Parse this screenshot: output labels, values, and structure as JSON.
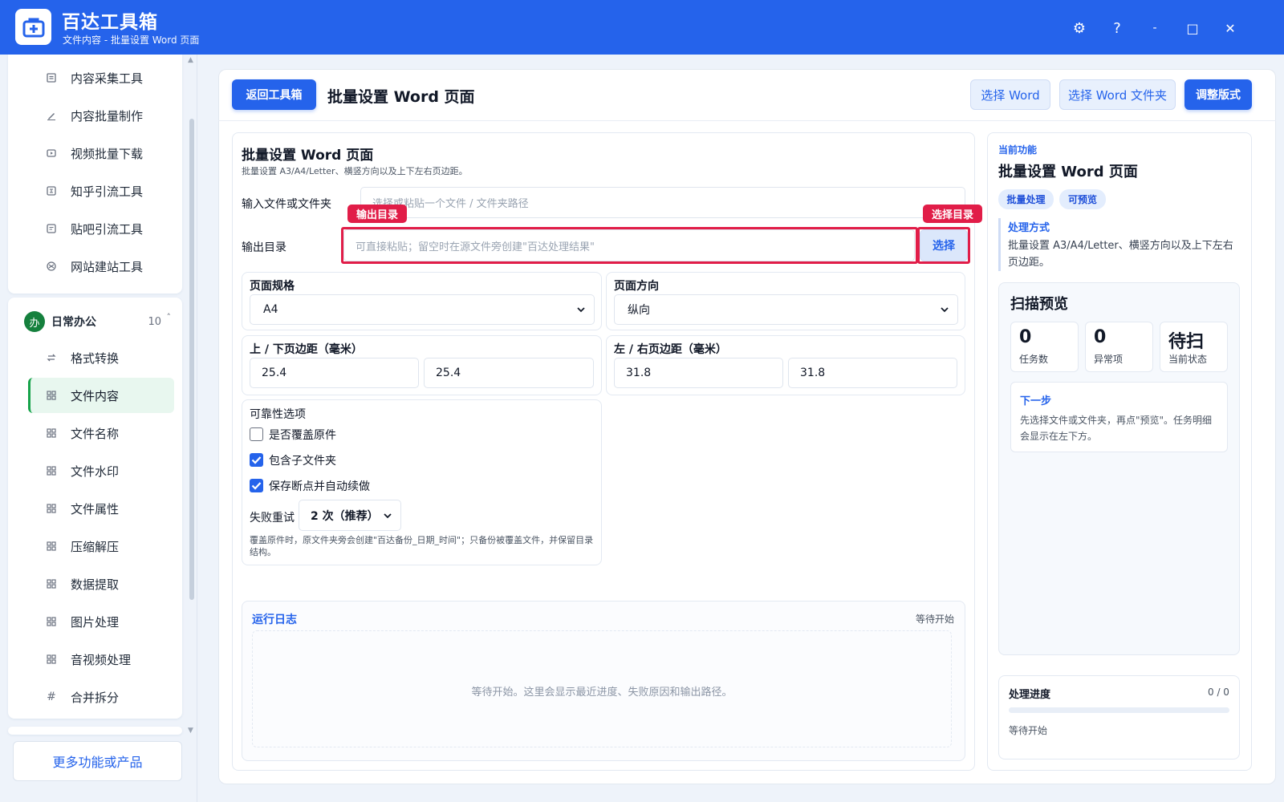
{
  "app": {
    "title": "百达工具箱",
    "subtitle": "文件内容 - 批量设置 Word 页面"
  },
  "window_controls": {
    "settings": "⚙",
    "help": "?",
    "minimize": "-",
    "maximize": "□",
    "close": "✕"
  },
  "sidebar": {
    "top_items": [
      {
        "label": "内容采集工具",
        "icon": "document-icon"
      },
      {
        "label": "内容批量制作",
        "icon": "pencil-icon"
      },
      {
        "label": "视频批量下载",
        "icon": "video-icon"
      },
      {
        "label": "知乎引流工具",
        "icon": "zhihu-icon"
      },
      {
        "label": "贴吧引流工具",
        "icon": "forum-icon"
      },
      {
        "label": "网站建站工具",
        "icon": "globe-icon"
      }
    ],
    "group": {
      "badge": "办",
      "label": "日常办公",
      "count": "10",
      "caret": "˄"
    },
    "group_items": [
      {
        "label": "格式转换",
        "icon": "swap-icon"
      },
      {
        "label": "文件内容",
        "icon": "grid-icon",
        "active": true
      },
      {
        "label": "文件名称",
        "icon": "grid-icon"
      },
      {
        "label": "文件水印",
        "icon": "grid-icon"
      },
      {
        "label": "文件属性",
        "icon": "grid-icon"
      },
      {
        "label": "压缩解压",
        "icon": "grid-icon"
      },
      {
        "label": "数据提取",
        "icon": "grid-icon"
      },
      {
        "label": "图片处理",
        "icon": "grid-icon"
      },
      {
        "label": "音视频处理",
        "icon": "grid-icon"
      },
      {
        "label": "合并拆分",
        "icon": "hash-icon"
      }
    ],
    "more_button": "更多功能或产品"
  },
  "toolbar": {
    "back_label": "返回工具箱",
    "page_title": "批量设置 Word 页面",
    "select_word": "选择 Word",
    "select_folder": "选择 Word 文件夹",
    "adjust_layout": "调整版式"
  },
  "form": {
    "title": "批量设置 Word 页面",
    "desc": "批量设置 A3/A4/Letter、横竖方向以及上下左右页边距。",
    "input_label": "输入文件或文件夹",
    "input_placeholder": "选择或粘贴一个文件 / 文件夹路径",
    "output_label": "输出目录",
    "output_placeholder": "可直接粘贴；留空时在源文件旁创建\"百达处理结果\"",
    "output_select": "选择",
    "tag_output": "输出目录",
    "tag_select": "选择目录",
    "page_size_label": "页面规格",
    "page_size_value": "A4",
    "orientation_label": "页面方向",
    "orientation_value": "纵向",
    "tb_margin_label": "上 / 下页边距（毫米）",
    "top_margin": "25.4",
    "bottom_margin": "25.4",
    "lr_margin_label": "左 / 右页边距（毫米）",
    "left_margin": "31.8",
    "right_margin": "31.8",
    "reliability_label": "可靠性选项",
    "options": [
      {
        "label": "是否覆盖原件",
        "checked": false
      },
      {
        "label": "包含子文件夹",
        "checked": true
      },
      {
        "label": "保存断点并自动续做",
        "checked": true
      }
    ],
    "retry_label": "失败重试",
    "retry_value": "2 次（推荐）",
    "note": "覆盖原件时，原文件夹旁会创建\"百达备份_日期_时间\"；只备份被覆盖文件，并保留目录结构。"
  },
  "log": {
    "title": "运行日志",
    "status": "等待开始",
    "empty": "等待开始。这里会显示最近进度、失败原因和输出路径。"
  },
  "right": {
    "current_label": "当前功能",
    "title": "批量设置 Word 页面",
    "pills": [
      "批量处理",
      "可预览"
    ],
    "method_label": "处理方式",
    "method_desc": "批量设置 A3/A4/Letter、横竖方向以及上下左右页边距。",
    "scan_title": "扫描预览",
    "stats": [
      {
        "value": "0",
        "label": "任务数"
      },
      {
        "value": "0",
        "label": "异常项"
      },
      {
        "value": "待扫",
        "label": "当前状态"
      }
    ],
    "next_title": "下一步",
    "next_desc": "先选择文件或文件夹，再点\"预览\"。任务明细会显示在左下方。",
    "progress_title": "处理进度",
    "progress_count": "0 / 0",
    "progress_fraction": 0,
    "progress_status": "等待开始"
  },
  "colors": {
    "brand": "#2563eb",
    "highlight": "#e11d48",
    "active_group": "#15803d"
  }
}
